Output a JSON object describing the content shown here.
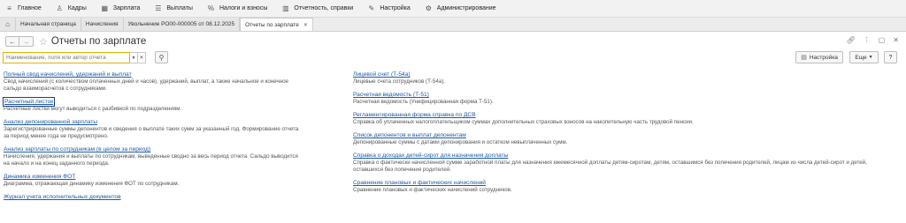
{
  "menu": [
    {
      "icon": "menu-lines-icon",
      "glyph": "≡",
      "label": "Главное"
    },
    {
      "icon": "person-icon",
      "glyph": "👤",
      "label": "Кадры"
    },
    {
      "icon": "calculator-icon",
      "glyph": "▦",
      "label": "Зарплата"
    },
    {
      "icon": "list-icon",
      "glyph": "☰",
      "label": "Выплаты"
    },
    {
      "icon": "percent-icon",
      "glyph": "%",
      "label": "Налоги и взносы"
    },
    {
      "icon": "chart-icon",
      "glyph": "▥",
      "label": "Отчетность, справки"
    },
    {
      "icon": "wrench-icon",
      "glyph": "✎",
      "label": "Настройка"
    },
    {
      "icon": "gear-icon",
      "glyph": "⚙",
      "label": "Администрирование"
    }
  ],
  "tabs": [
    {
      "label": "Начальная страница"
    },
    {
      "label": "Начисления"
    },
    {
      "label": "Увольнение РО00-000005 от 08.12.2025"
    },
    {
      "label": "Отчеты по зарплате"
    }
  ],
  "title": "Отчеты по зарплате",
  "search": {
    "placeholder": "Наименование, поля или автор отчета"
  },
  "buttons": {
    "settings": "Настройка",
    "more": "Еще",
    "help": "?"
  },
  "left_reports": [
    {
      "title": "Полный свод начислений, удержаний и выплат",
      "desc": "Свод начислений (с количеством оплаченных дней и часов), удержаний, выплат, а также начальное и конечное сальдо взаиморасчетов с сотрудниками."
    },
    {
      "title": "Расчетный листок",
      "desc": "Расчетные листки могут выводиться с разбивкой по подразделениям."
    },
    {
      "title": "Анализ депонированной зарплаты",
      "desc": "Зарегистрированные суммы депонентов и сведения о выплате таких сумм за указанный год. Формирование отчета за период менее года не предусмотрено."
    },
    {
      "title": "Анализ зарплаты по сотрудникам (в целом за период)",
      "desc": "Начисления, удержания и выплаты по сотрудникам, выведенные сводно за весь период отчета. Сальдо выводится на начало и на конец заданного периода."
    },
    {
      "title": "Динамика изменения ФОТ",
      "desc": "Диаграмма, отражающая динамику изменения ФОТ по сотрудникам."
    },
    {
      "title": "Журнал учета исполнительных документов",
      "desc": ""
    }
  ],
  "right_reports": [
    {
      "title": "Лицевой счет (Т-54а)",
      "desc": "Лицевые счета сотрудников (Т-54а)."
    },
    {
      "title": "Расчетная ведомость (Т-51)",
      "desc": "Расчетная ведомость (Унифицированная форма Т-51)."
    },
    {
      "title": "Регламентированная форма справка по ДСВ",
      "desc": "Справка об уплаченных налогоплательщиком суммах дополнительных страховых взносов на накопительную часть трудовой пенсии."
    },
    {
      "title": "Список депонентов и выплат депонентам",
      "desc": "Депонированные суммы с датами депонирования и остатком невыплаченных сумм."
    },
    {
      "title": "Справка о доходах детей-сирот для назначения доплаты",
      "desc": "Справка о фактически начисленной сумме заработной платы для назначения ежемесячной доплаты детям-сиротам, детям, оставшимся без попечения родителей, лицам из числа детей-сирот и детей, оставшихся без попечения родителей."
    },
    {
      "title": "Сравнение плановых и фактических начислений",
      "desc": "Сравнение плановых и фактических начислений сотрудников."
    }
  ]
}
